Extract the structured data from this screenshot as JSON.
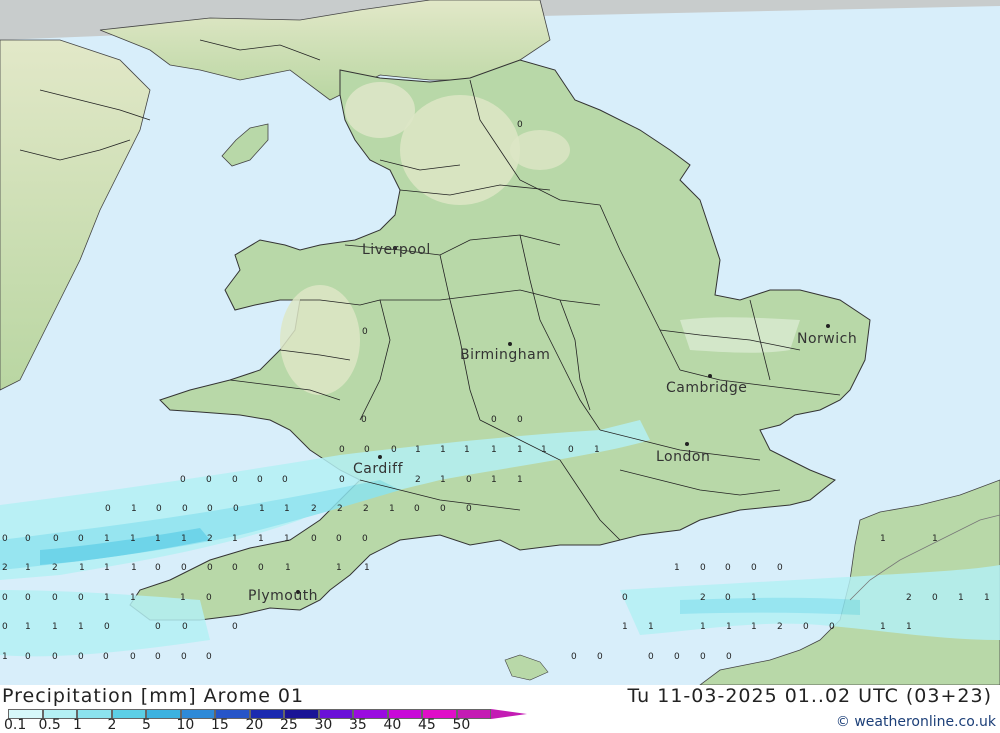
{
  "map": {
    "cities": [
      {
        "name": "Liverpool"
      },
      {
        "name": "Birmingham"
      },
      {
        "name": "Cambridge"
      },
      {
        "name": "Norwich"
      },
      {
        "name": "London"
      },
      {
        "name": "Cardiff"
      },
      {
        "name": "Plymouth"
      }
    ],
    "values": [
      "0",
      "0",
      "0",
      "0",
      "0",
      "0",
      "0",
      "0",
      "1",
      "1",
      "1",
      "1",
      "1",
      "1",
      "0",
      "1",
      "0",
      "0",
      "0",
      "0",
      "0",
      "0",
      "2",
      "1",
      "0",
      "1",
      "1",
      "0",
      "1",
      "0",
      "0",
      "0",
      "0",
      "1",
      "1",
      "2",
      "2",
      "2",
      "1",
      "0",
      "0",
      "0",
      "0",
      "0",
      "0",
      "0",
      "1",
      "1",
      "1",
      "1",
      "2",
      "1",
      "1",
      "1",
      "0",
      "0",
      "0",
      "1",
      "1",
      "2",
      "1",
      "2",
      "1",
      "1",
      "1",
      "0",
      "0",
      "0",
      "0",
      "0",
      "1",
      "1",
      "1",
      "1",
      "0",
      "0",
      "0",
      "0",
      "0",
      "0",
      "0",
      "0",
      "1",
      "1",
      "1",
      "0",
      "0",
      "2",
      "0",
      "1",
      "2",
      "0",
      "1",
      "1",
      "0",
      "1",
      "1",
      "1",
      "0",
      "0",
      "0",
      "0",
      "1",
      "1",
      "1",
      "1",
      "1",
      "2",
      "0",
      "0",
      "1",
      "1",
      "1",
      "0",
      "0",
      "0",
      "0",
      "0",
      "0",
      "0",
      "0",
      "0",
      "0",
      "0",
      "0",
      "0",
      "0"
    ]
  },
  "footer": {
    "title_left": "Precipitation [mm] Arome 01",
    "title_right": "Tu 11-03-2025 01..02 UTC (03+23)",
    "credit": "© weatheronline.co.uk",
    "legend": [
      {
        "label": "0.1",
        "color": "#d7f8fa"
      },
      {
        "label": "0.5",
        "color": "#b4f0f4"
      },
      {
        "label": "1",
        "color": "#8ce3ee"
      },
      {
        "label": "2",
        "color": "#5ccfe6"
      },
      {
        "label": "5",
        "color": "#3cb2e0"
      },
      {
        "label": "10",
        "color": "#2e8ad8"
      },
      {
        "label": "15",
        "color": "#2655c8"
      },
      {
        "label": "20",
        "color": "#1b2ab0"
      },
      {
        "label": "25",
        "color": "#1a1496"
      },
      {
        "label": "30",
        "color": "#6a10d8"
      },
      {
        "label": "35",
        "color": "#9a0ce0"
      },
      {
        "label": "40",
        "color": "#c808d8"
      },
      {
        "label": "45",
        "color": "#e00ec8"
      },
      {
        "label": "50",
        "color": "#c41cb4"
      }
    ]
  },
  "colors": {
    "sea": "#d8eefa",
    "land": "#b8d8a8",
    "highland": "#d8e4c0",
    "borders": "#222222",
    "precip_light": "#b4f0f4",
    "precip_mid": "#5ccfe6"
  }
}
